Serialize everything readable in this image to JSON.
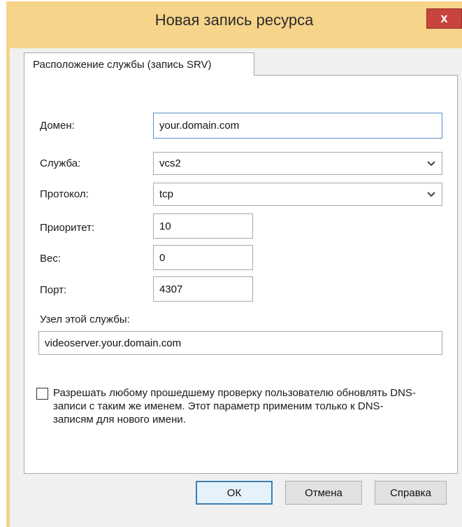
{
  "window": {
    "title": "Новая запись ресурса",
    "close_label": "x"
  },
  "tab": {
    "label": "Расположение службы (запись SRV)"
  },
  "form": {
    "domain": {
      "label": "Домен:",
      "value": "your.domain.com"
    },
    "service": {
      "label": "Служба:",
      "value": "vcs2"
    },
    "protocol": {
      "label": "Протокол:",
      "value": "tcp"
    },
    "priority": {
      "label": "Приоритет:",
      "value": "10"
    },
    "weight": {
      "label": "Вес:",
      "value": "0"
    },
    "port": {
      "label": "Порт:",
      "value": "4307"
    },
    "host": {
      "label": "Узел этой службы:",
      "value": "videoserver.your.domain.com"
    }
  },
  "checkbox": {
    "checked": false,
    "label": "Разрешать любому прошедшему проверку пользователю обновлять DNS-записи с таким же именем. Этот параметр применим только к DNS-записям для нового имени."
  },
  "buttons": {
    "ok": "ОК",
    "cancel": "Отмена",
    "help": "Справка"
  },
  "colors": {
    "window_frame": "#f6d48a",
    "close_button": "#c7453c",
    "focus_border": "#5a8ccb"
  }
}
